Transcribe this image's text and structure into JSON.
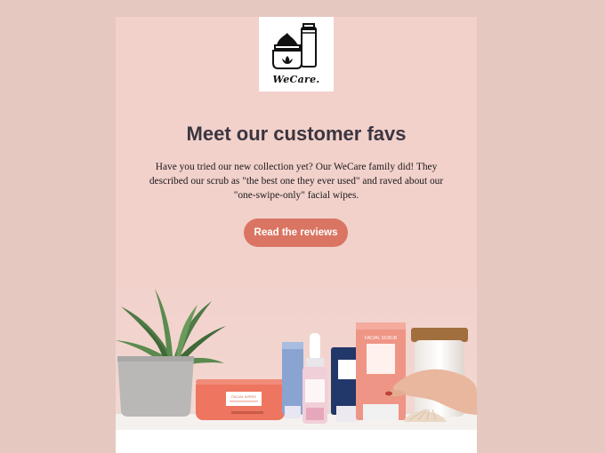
{
  "logo": {
    "brand": "WeCare.",
    "icon": "skincare-jar-tube-icon"
  },
  "headline": "Meet our customer favs",
  "body_text": "Have you tried our new collection yet? Our WeCare family did! They described our scrub as \"the best one they ever used\" and raved about our \"one-swipe-only\" facial wipes.",
  "cta_label": "Read the reviews",
  "hero": {
    "description_icon": "product-lineup-image",
    "wipes_label": "FACIAL WIPES",
    "scrub_label": "FACIAL SCRUB"
  },
  "colors": {
    "page_bg": "#e5c8bf",
    "email_bg": "#f2d1cb",
    "cta": "#d97562",
    "headline": "#3b3540"
  }
}
